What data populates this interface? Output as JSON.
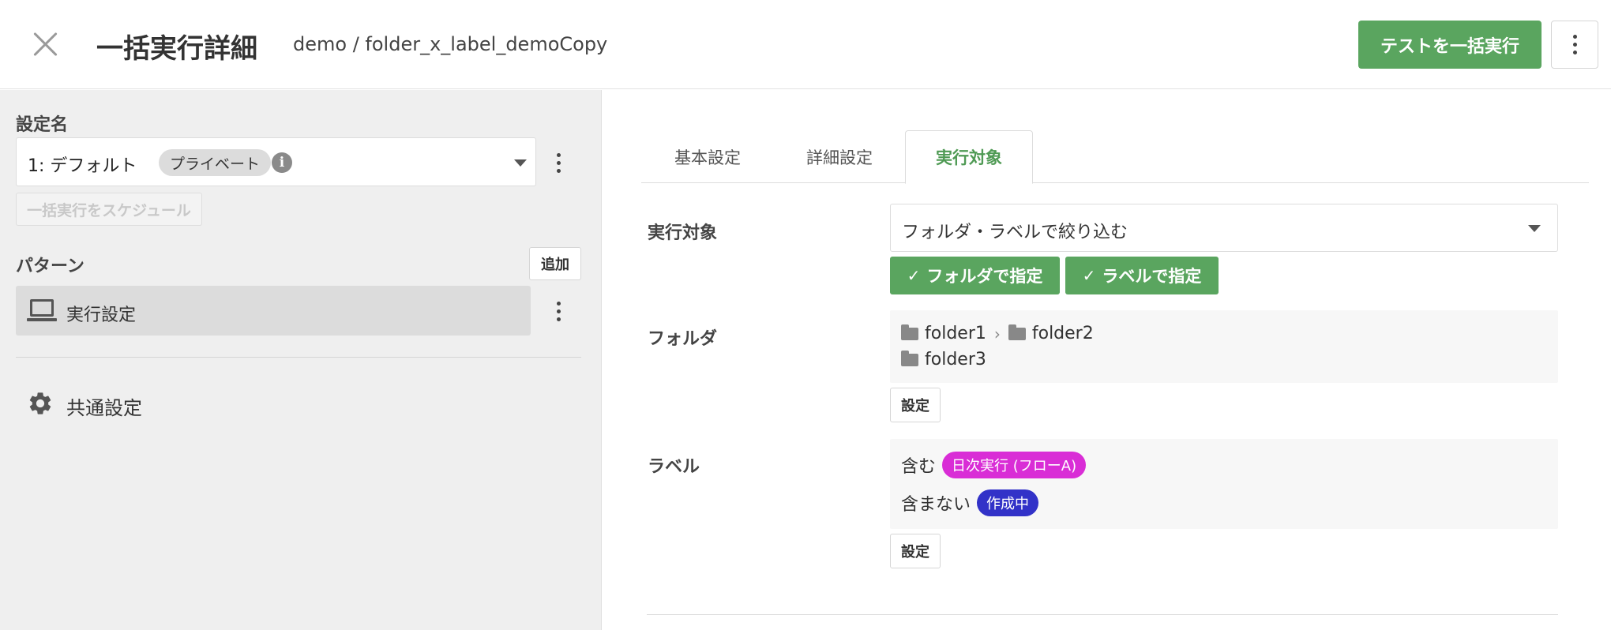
{
  "header": {
    "title": "一括実行詳細",
    "breadcrumb": "demo / folder_x_label_demoCopy",
    "run_all_label": "テストを一括実行"
  },
  "sidebar": {
    "setting_label": "設定名",
    "setting_value": "1: デフォルト",
    "private_badge": "プライベート",
    "info_glyph": "i",
    "schedule_label": "一括実行をスケジュール",
    "pattern_label": "パターン",
    "add_label": "追加",
    "pattern_item": "実行設定",
    "common_settings": "共通設定"
  },
  "tabs": [
    {
      "label": "基本設定"
    },
    {
      "label": "詳細設定"
    },
    {
      "label": "実行対象",
      "active": true
    }
  ],
  "target": {
    "label": "実行対象",
    "select_value": "フォルダ・ラベルで絞り込む",
    "by_folder_label": "フォルダで指定",
    "by_label_label": "ラベルで指定",
    "check_glyph": "✓"
  },
  "folder": {
    "label": "フォルダ",
    "paths": [
      "folder1",
      "folder2",
      "folder3"
    ],
    "chevron": "›",
    "set_label": "設定"
  },
  "labels": {
    "label": "ラベル",
    "include_label": "含む",
    "include_tag": "日次実行 (フローA)",
    "exclude_label": "含まない",
    "exclude_tag": "作成中",
    "set_label": "設定"
  },
  "colors": {
    "primary_green": "#5aa55f",
    "active_tab": "#4f9a54",
    "include_tag": "#d92dd6",
    "exclude_tag": "#3232c8"
  }
}
